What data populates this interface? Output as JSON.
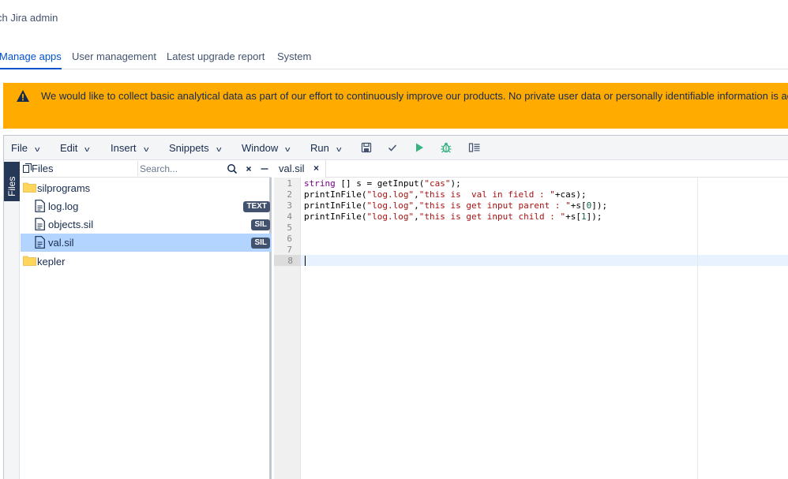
{
  "header": {
    "title": "ch Jira admin"
  },
  "tabs": [
    {
      "label": "Manage apps",
      "active": true
    },
    {
      "label": "User management",
      "active": false
    },
    {
      "label": "Latest upgrade report",
      "active": false
    },
    {
      "label": "System",
      "active": false
    }
  ],
  "banner": {
    "icon": "warning-icon",
    "text": "We would like to collect basic analytical data as part of our effort to continuously improve our products. No private user data or personally identifiable information is acces",
    "color": "#ffab00"
  },
  "menubar": {
    "items": [
      "File",
      "Edit",
      "Insert",
      "Snippets",
      "Window",
      "Run"
    ],
    "tools": [
      "save-icon",
      "check-icon",
      "run-icon",
      "debug-icon",
      "outline-icon"
    ]
  },
  "side_rail": {
    "label": "Files"
  },
  "files_panel": {
    "title": "Files",
    "search_placeholder": "Search...",
    "tree": [
      {
        "label": "silprograms",
        "type": "folder",
        "badge": ""
      },
      {
        "label": "log.log",
        "type": "file",
        "badge": "TEXT"
      },
      {
        "label": "objects.sil",
        "type": "file",
        "badge": "SIL"
      },
      {
        "label": "val.sil",
        "type": "file",
        "badge": "SIL",
        "selected": true
      },
      {
        "label": "kepler",
        "type": "folder",
        "badge": ""
      }
    ]
  },
  "editor": {
    "tab_label": "val.sil",
    "tab_close": "×",
    "line_numbers": [
      "1",
      "2",
      "3",
      "4",
      "5",
      "6",
      "7",
      "8"
    ],
    "lines": [
      "string [] s = getInput(\"cas\");",
      "printInFile(\"log.log\",\"this is  val in field : \"+cas);",
      "printInFile(\"log.log\",\"this is get input parent : \"+s[0]);",
      "printInFile(\"log.log\",\"this is get input child : \"+s[1]);",
      "",
      "",
      "",
      ""
    ],
    "active_line": "8"
  },
  "colors": {
    "accent": "#0052cc",
    "selected_row": "#b3d4ff",
    "badge": "#42526e"
  }
}
